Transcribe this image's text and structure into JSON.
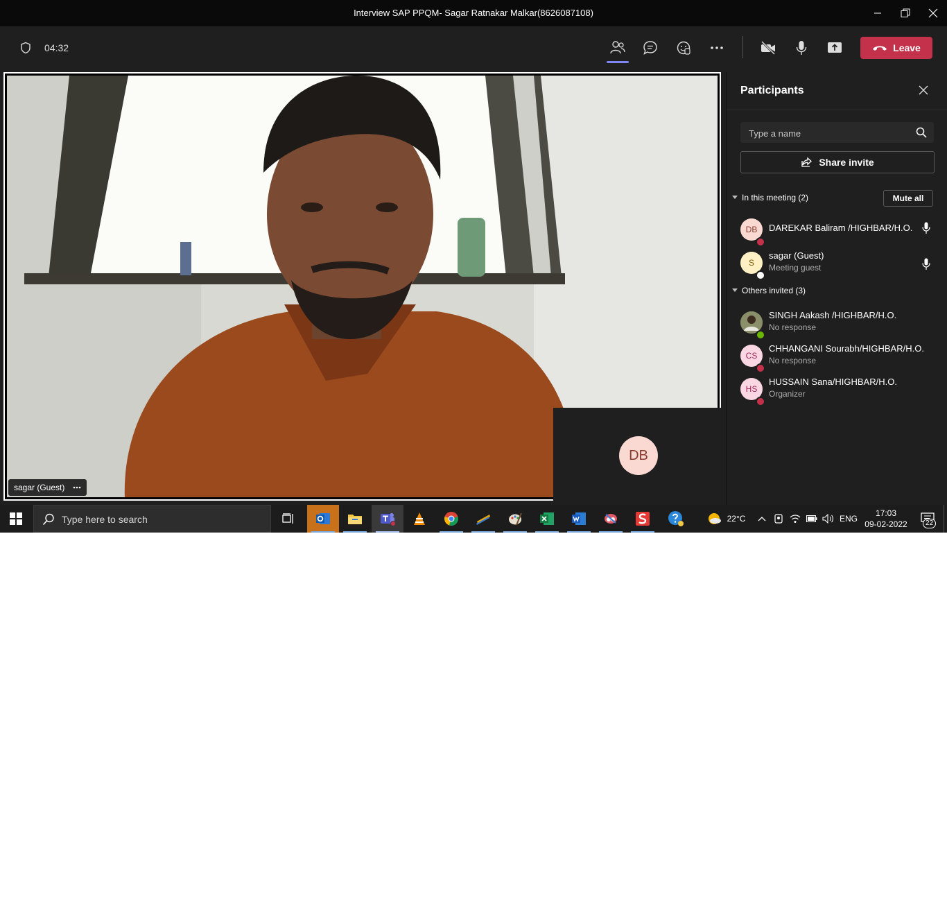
{
  "window": {
    "title": "Interview SAP PPQM- Sagar Ratnakar Malkar(8626087108)"
  },
  "toolbar": {
    "timer": "04:32",
    "leave_label": "Leave",
    "icons": [
      "shield-icon",
      "people-icon",
      "chat-icon",
      "raise-hand-icon",
      "more-icon",
      "camera-off-icon",
      "mic-icon",
      "share-screen-icon",
      "phone-hangup-icon"
    ]
  },
  "stage": {
    "main_name": "sagar (Guest)",
    "self_initials": "DB"
  },
  "participants_panel": {
    "title": "Participants",
    "search_placeholder": "Type a name",
    "share_invite_label": "Share invite",
    "in_meeting_label": "In this meeting (2)",
    "mute_all_label": "Mute all",
    "others_invited_label": "Others invited (3)",
    "in_meeting": [
      {
        "initials": "DB",
        "name": "DAREKAR Baliram /HIGHBAR/H.O.",
        "subtitle": "",
        "avatar_bg": "#fbd9d3",
        "avatar_fg": "#8a3a2b",
        "status_color": "#c4314b"
      },
      {
        "initials": "S",
        "name": "sagar (Guest)",
        "subtitle": "Meeting guest",
        "avatar_bg": "#fff1c4",
        "avatar_fg": "#7a5a00",
        "status_color": "#ffffff"
      }
    ],
    "invited": [
      {
        "initials": "",
        "name": "SINGH Aakash /HIGHBAR/H.O.",
        "subtitle": "No response",
        "avatar_bg": "#8a8f6a",
        "avatar_fg": "#ffffff",
        "status_color": "#6bb700"
      },
      {
        "initials": "CS",
        "name": "CHHANGANI Sourabh/HIGHBAR/H.O.",
        "subtitle": "No response",
        "avatar_bg": "#fbd6e3",
        "avatar_fg": "#a3285a",
        "status_color": "#c4314b"
      },
      {
        "initials": "HS",
        "name": "HUSSAIN Sana/HIGHBAR/H.O.",
        "subtitle": "Organizer",
        "avatar_bg": "#fbd6e3",
        "avatar_fg": "#a3285a",
        "status_color": "#c4314b"
      }
    ]
  },
  "taskbar": {
    "search_placeholder": "Type here to search",
    "weather": "22°C",
    "language": "ENG",
    "time": "17:03",
    "date": "09-02-2022",
    "notifications": "22",
    "apps": [
      "outlook-icon",
      "file-explorer-icon",
      "teams-icon",
      "vlc-icon",
      "chrome-icon",
      "sticky-app-icon",
      "paint-icon",
      "excel-icon",
      "word-icon",
      "snipping-icon",
      "sketch-app-icon",
      "help-icon"
    ]
  },
  "colors": {
    "accent": "#7f85f5",
    "leave": "#c4314b",
    "background": "#1f1f1f"
  }
}
